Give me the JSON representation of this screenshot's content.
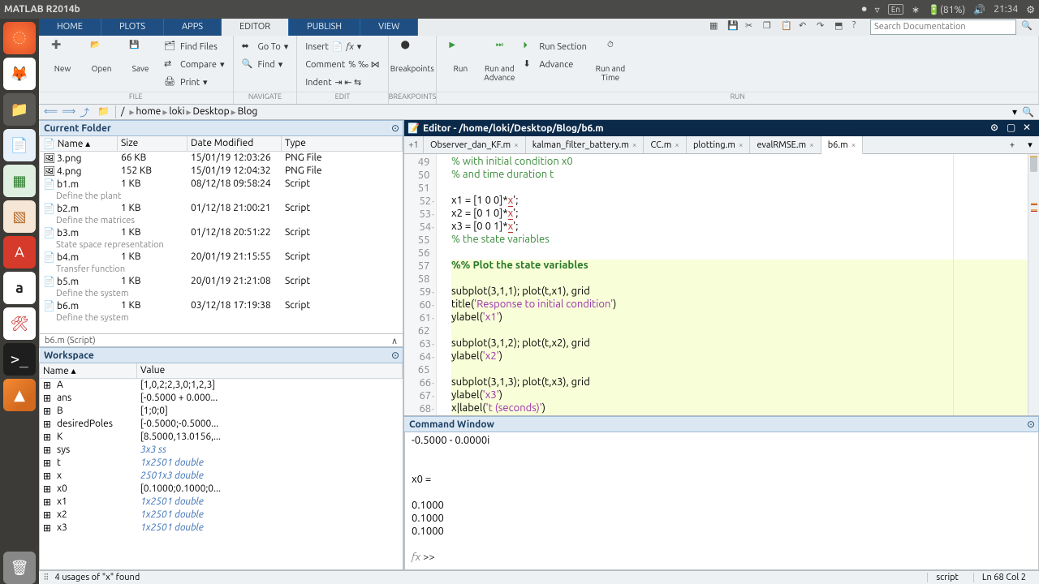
{
  "os_bar": {
    "app_title": "MATLAB R2014b",
    "battery": "(81%)",
    "time": "21:34",
    "lang": "En"
  },
  "ribbon_tabs": [
    "HOME",
    "PLOTS",
    "APPS",
    "EDITOR",
    "PUBLISH",
    "VIEW"
  ],
  "active_ribbon_tab": "EDITOR",
  "search_placeholder": "Search Documentation",
  "toolstrip": {
    "file": {
      "label": "FILE",
      "new": "New",
      "open": "Open",
      "save": "Save",
      "find_files": "Find Files",
      "compare": "Compare",
      "print": "Print"
    },
    "navigate": {
      "label": "NAVIGATE",
      "goto": "Go To",
      "find": "Find"
    },
    "edit": {
      "label": "EDIT",
      "insert": "Insert",
      "comment": "Comment",
      "indent": "Indent"
    },
    "breakpoints": {
      "label": "BREAKPOINTS",
      "btn": "Breakpoints"
    },
    "run": {
      "label": "RUN",
      "run": "Run",
      "run_advance": "Run and\nAdvance",
      "run_section": "Run Section",
      "advance": "Advance",
      "run_time": "Run and\nTime"
    }
  },
  "breadcrumb": [
    "home",
    "loki",
    "Desktop",
    "Blog"
  ],
  "current_folder": {
    "title": "Current Folder",
    "columns": [
      "Name",
      "Size",
      "Date Modified",
      "Type"
    ],
    "rows": [
      {
        "n": "3.png",
        "s": "66 KB",
        "d": "15/01/19 12:03:26",
        "t": "PNG File",
        "sub": null,
        "kind": "png"
      },
      {
        "n": "4.png",
        "s": "152 KB",
        "d": "15/01/19 12:04:32",
        "t": "PNG File",
        "sub": null,
        "kind": "png"
      },
      {
        "n": "b1.m",
        "s": "1 KB",
        "d": "08/12/18 09:58:24",
        "t": "Script",
        "sub": "Define the plant",
        "kind": "m"
      },
      {
        "n": "b2.m",
        "s": "1 KB",
        "d": "01/12/18 21:00:21",
        "t": "Script",
        "sub": "Define the matrices",
        "kind": "m"
      },
      {
        "n": "b3.m",
        "s": "1 KB",
        "d": "01/12/18 20:51:22",
        "t": "Script",
        "sub": "State space representation",
        "kind": "m"
      },
      {
        "n": "b4.m",
        "s": "1 KB",
        "d": "20/01/19 21:15:55",
        "t": "Script",
        "sub": "Transfer function",
        "kind": "m"
      },
      {
        "n": "b5.m",
        "s": "1 KB",
        "d": "20/01/19 21:21:08",
        "t": "Script",
        "sub": "Define the system",
        "kind": "m"
      },
      {
        "n": "b6.m",
        "s": "1 KB",
        "d": "03/12/18 17:19:38",
        "t": "Script",
        "sub": "Define the system",
        "kind": "m"
      }
    ],
    "detail": "b6.m (Script)"
  },
  "workspace": {
    "title": "Workspace",
    "columns": [
      "Name",
      "Value"
    ],
    "rows": [
      {
        "n": "A",
        "v": "[1,0,2;2,3,0;1,2,3]",
        "ital": false
      },
      {
        "n": "ans",
        "v": "[-0.5000 + 0.000...",
        "ital": false
      },
      {
        "n": "B",
        "v": "[1;0;0]",
        "ital": false
      },
      {
        "n": "desiredPoles",
        "v": "[-0.5000;-0.5000...",
        "ital": false
      },
      {
        "n": "K",
        "v": "[8.5000,13.0156,...",
        "ital": false
      },
      {
        "n": "sys",
        "v": "3x3 ss",
        "ital": true
      },
      {
        "n": "t",
        "v": "1x2501 double",
        "ital": true
      },
      {
        "n": "x",
        "v": "2501x3 double",
        "ital": true
      },
      {
        "n": "x0",
        "v": "[0.1000;0.1000;0...",
        "ital": false
      },
      {
        "n": "x1",
        "v": "1x2501 double",
        "ital": true
      },
      {
        "n": "x2",
        "v": "1x2501 double",
        "ital": true
      },
      {
        "n": "x3",
        "v": "1x2501 double",
        "ital": true
      }
    ]
  },
  "editor": {
    "title": "Editor - /home/loki/Desktop/Blog/b6.m",
    "tabs": [
      "Observer_dan_KF.m",
      "kalman_filter_battery.m",
      "CC.m",
      "plotting.m",
      "evalRMSE.m",
      "b6.m"
    ],
    "active_tab": "b6.m",
    "first_line": 49,
    "lines": [
      {
        "n": 49,
        "d": false,
        "html": "<span class='cm'>% with initial condition x0</span>"
      },
      {
        "n": 50,
        "d": false,
        "html": "<span class='cm'>% and time duration t</span>"
      },
      {
        "n": 51,
        "d": false,
        "html": ""
      },
      {
        "n": 52,
        "d": true,
        "html": "x1 = [1 0 0]*<span class='err'>x</span>';"
      },
      {
        "n": 53,
        "d": true,
        "html": "x2 = [0 1 0]*<span class='err'>x</span>';"
      },
      {
        "n": 54,
        "d": true,
        "html": "x3 = [0 0 1]*<span class='err'>x</span>';"
      },
      {
        "n": 55,
        "d": false,
        "html": "<span class='cm'>% the state variables</span>"
      },
      {
        "n": 56,
        "d": false,
        "html": ""
      },
      {
        "n": 57,
        "d": false,
        "hl": true,
        "html": "<span class='sec'>%% Plot the state variables</span>"
      },
      {
        "n": 58,
        "d": false,
        "hl": true,
        "html": ""
      },
      {
        "n": 59,
        "d": true,
        "hl": true,
        "html": "subplot(3,1,1); plot(t,x1), grid"
      },
      {
        "n": 60,
        "d": true,
        "hl": true,
        "html": "title(<span class='str'>'Response to initial condition'</span>)"
      },
      {
        "n": 61,
        "d": true,
        "hl": true,
        "html": "ylabel(<span class='str'>'x1'</span>)"
      },
      {
        "n": 62,
        "d": false,
        "hl": true,
        "html": ""
      },
      {
        "n": 63,
        "d": true,
        "hl": true,
        "html": "subplot(3,1,2); plot(t,x2), grid"
      },
      {
        "n": 64,
        "d": true,
        "hl": true,
        "html": "ylabel(<span class='str'>'x2'</span>)"
      },
      {
        "n": 65,
        "d": false,
        "hl": true,
        "html": ""
      },
      {
        "n": 66,
        "d": true,
        "hl": true,
        "html": "subplot(3,1,3); plot(t,x3), grid"
      },
      {
        "n": 67,
        "d": true,
        "hl": true,
        "html": "ylabel(<span class='str'>'x3'</span>)"
      },
      {
        "n": 68,
        "d": true,
        "hl": true,
        "html": "x<span>|</span>label(<span class='str'>'t (seconds)'</span>)"
      }
    ]
  },
  "command_window": {
    "title": "Command Window",
    "lines": [
      "   -0.5000 - 0.0000i",
      "",
      "",
      "x0 =",
      "",
      "    0.1000",
      "    0.1000",
      "    0.1000",
      ""
    ],
    "prompt": ">>"
  },
  "status": {
    "usages": "4 usages of \"x\" found",
    "mode": "script",
    "pos": "Ln  68   Col  2"
  }
}
